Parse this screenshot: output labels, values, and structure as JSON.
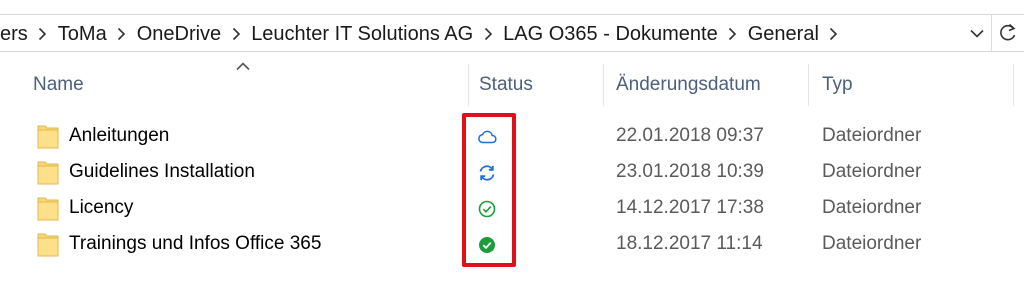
{
  "address_bar": {
    "crumbs": [
      "ers",
      "ToMa",
      "OneDrive",
      "Leuchter IT Solutions AG",
      "LAG O365 - Dokumente",
      "General"
    ]
  },
  "columns": {
    "name": "Name",
    "status": "Status",
    "date": "Änderungsdatum",
    "type": "Typ"
  },
  "rows": [
    {
      "name": "Anleitungen",
      "status_icon": "cloud-icon",
      "date": "22.01.2018 09:37",
      "type": "Dateiordner"
    },
    {
      "name": "Guidelines Installation",
      "status_icon": "sync-icon",
      "date": "23.01.2018 10:39",
      "type": "Dateiordner"
    },
    {
      "name": "Licency",
      "status_icon": "check-outline-icon",
      "date": "14.12.2017 17:38",
      "type": "Dateiordner"
    },
    {
      "name": "Trainings und Infos Office 365",
      "status_icon": "check-filled-icon",
      "date": "18.12.2017 11:14",
      "type": "Dateiordner"
    }
  ],
  "colors": {
    "sync_blue": "#1e6fd9",
    "check_green": "#1d9c3c",
    "highlight_red": "#e0101a",
    "folder_yellow": "#f8d775"
  }
}
